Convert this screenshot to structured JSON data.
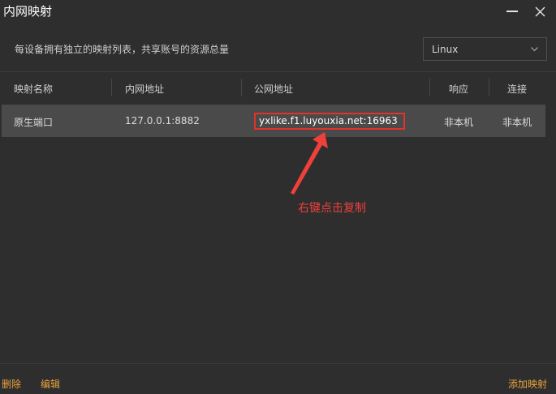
{
  "window": {
    "title": "内网映射",
    "minimize_icon": "minimize-icon",
    "close_icon": "close-icon"
  },
  "description": "每设备拥有独立的映射列表，共享账号的资源总量",
  "platform_select": {
    "value": "Linux",
    "icon": "chevron-down-icon"
  },
  "table": {
    "columns": [
      "映射名称",
      "内网地址",
      "公网地址",
      "响应",
      "连接"
    ],
    "rows": [
      {
        "name": "原生端口",
        "internal": "127.0.0.1:8882",
        "public": "yxlike.f1.luyouxia.net:16963",
        "response": "非本机",
        "connection": "非本机"
      }
    ]
  },
  "annotation": {
    "text": "右键点击复制",
    "color": "#f0403a"
  },
  "footer": {
    "delete_label": "删除",
    "edit_label": "编辑",
    "add_label": "添加映射",
    "link_color": "#e8a33d"
  }
}
